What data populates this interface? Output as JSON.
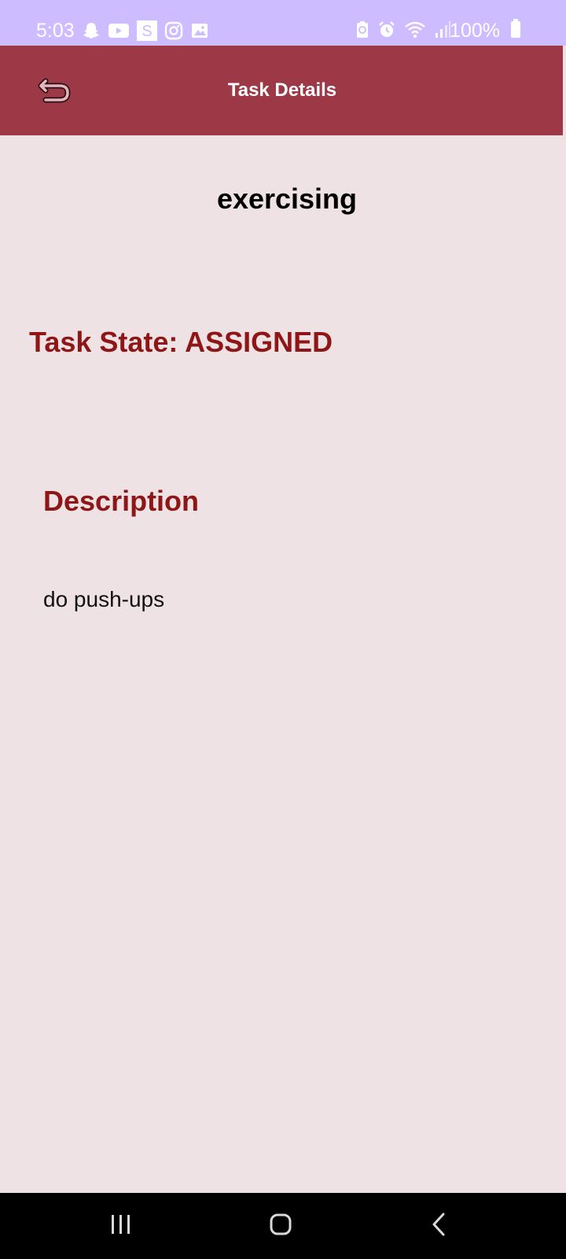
{
  "status_bar": {
    "time": "5:03",
    "battery": "100%",
    "left_icons": [
      "snapchat-icon",
      "youtube-icon",
      "s-app-icon",
      "instagram-icon",
      "gallery-icon"
    ],
    "right_icons": [
      "battery-saver-icon",
      "alarm-icon",
      "wifi-icon",
      "signal-icon"
    ]
  },
  "app_bar": {
    "title": "Task Details",
    "back_icon": "undo-arrow-icon"
  },
  "task": {
    "name": "exercising",
    "state_text": "Task State: ASSIGNED",
    "description_heading": "Description",
    "description": "do push-ups"
  },
  "nav_bar": {
    "buttons": [
      "recent-apps",
      "home",
      "back"
    ]
  },
  "colors": {
    "status_bar": "#cdbcff",
    "app_bar": "#9d3846",
    "background": "#efe2e4",
    "accent_text": "#8e1616"
  }
}
